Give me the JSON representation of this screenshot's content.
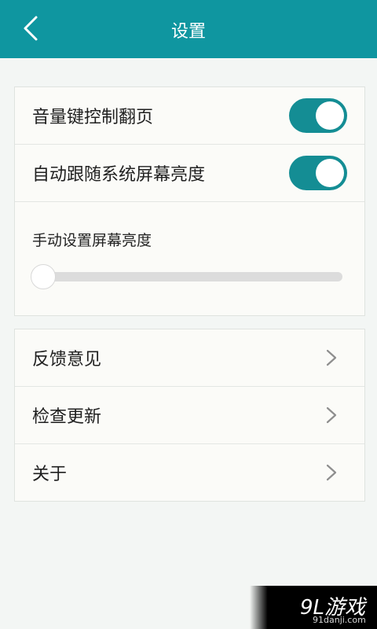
{
  "header": {
    "title": "设置"
  },
  "settings": {
    "volume_key": {
      "label": "音量键控制翻页",
      "on": true
    },
    "auto_brightness": {
      "label": "自动跟随系统屏幕亮度",
      "on": true
    },
    "manual_brightness": {
      "label": "手动设置屏幕亮度",
      "level": 0
    }
  },
  "menu": {
    "feedback": "反馈意见",
    "check_update": "检查更新",
    "about": "关于"
  },
  "watermark": {
    "brand": "9L游戏",
    "url": "91danji.com"
  },
  "colors": {
    "accent": "#0f96a0",
    "toggle_on": "#148d94",
    "background": "#f3f6f4"
  }
}
